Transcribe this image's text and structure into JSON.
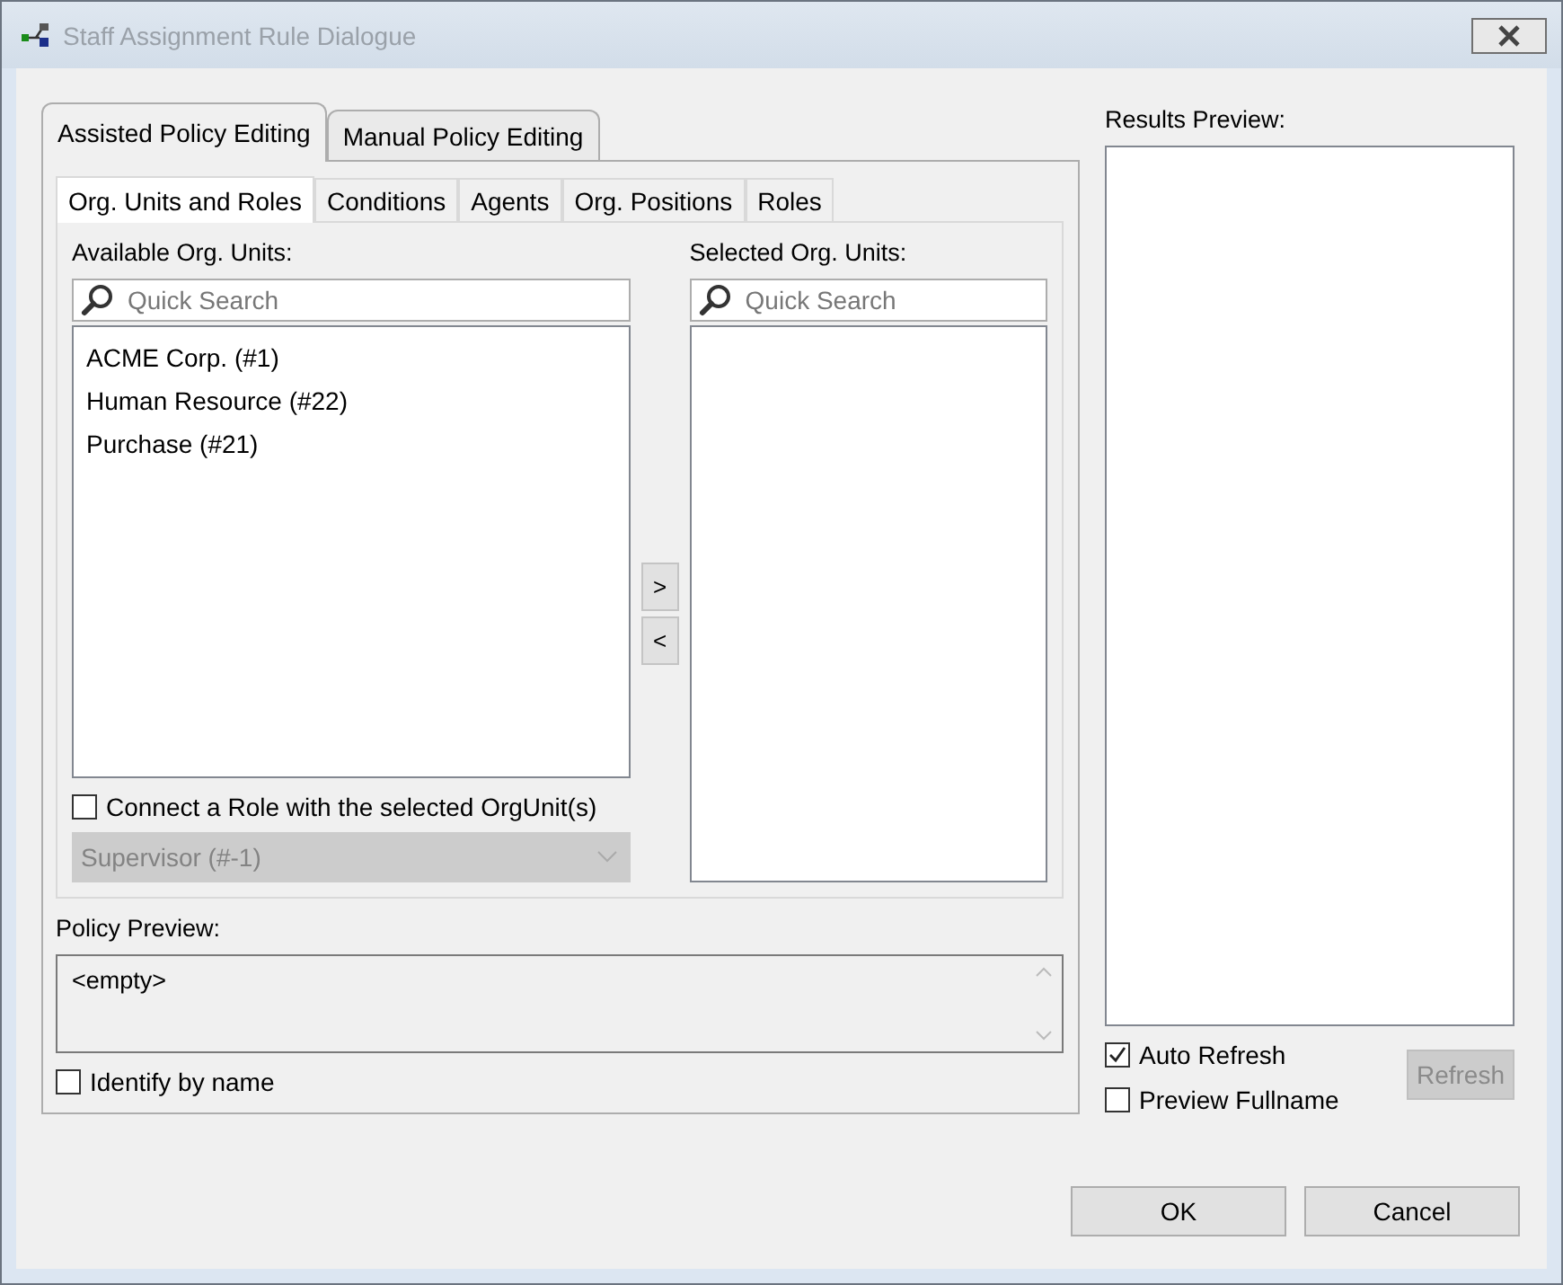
{
  "window": {
    "title": "Staff Assignment Rule Dialogue"
  },
  "outer_tabs": [
    {
      "label": "Assisted Policy Editing",
      "selected": true
    },
    {
      "label": "Manual Policy Editing",
      "selected": false
    }
  ],
  "inner_tabs": [
    {
      "label": "Org. Units and Roles",
      "selected": true
    },
    {
      "label": "Conditions",
      "selected": false
    },
    {
      "label": "Agents",
      "selected": false
    },
    {
      "label": "Org. Positions",
      "selected": false
    },
    {
      "label": "Roles",
      "selected": false
    }
  ],
  "available": {
    "label": "Available Org. Units:",
    "placeholder": "Quick Search",
    "items": [
      "ACME Corp. (#1)",
      "Human Resource (#22)",
      "Purchase (#21)"
    ]
  },
  "move_buttons": [
    ">",
    "<"
  ],
  "selected_units": {
    "label": "Selected Org. Units:",
    "placeholder": "Quick Search"
  },
  "connect_role": {
    "label": "Connect a Role with the selected OrgUnit(s)",
    "checked": false
  },
  "role_dropdown": {
    "value": "Supervisor (#-1)",
    "disabled": true
  },
  "policy_preview": {
    "label": "Policy Preview:",
    "value": "<empty>"
  },
  "identify_by_name": {
    "label": "Identify by name",
    "checked": false
  },
  "results_preview": {
    "label": "Results Preview:"
  },
  "auto_refresh": {
    "label": "Auto Refresh",
    "checked": true
  },
  "preview_fullname": {
    "label": "Preview Fullname",
    "checked": false
  },
  "refresh_button": {
    "label": "Refresh",
    "disabled": true
  },
  "buttons": [
    "OK",
    "Cancel"
  ]
}
